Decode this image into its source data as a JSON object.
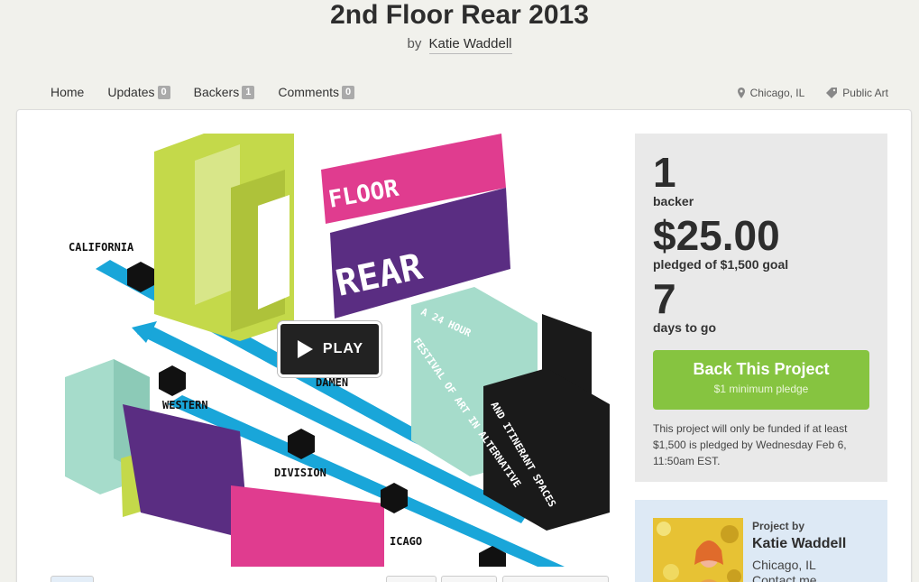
{
  "project": {
    "title": "2nd Floor Rear 2013",
    "by_label": "by",
    "creator": "Katie Waddell"
  },
  "nav": {
    "home": "Home",
    "updates": "Updates",
    "updates_count": "0",
    "backers": "Backers",
    "backers_count": "1",
    "comments": "Comments",
    "comments_count": "0"
  },
  "meta": {
    "location": "Chicago, IL",
    "category": "Public Art"
  },
  "video": {
    "play_label": "PLAY",
    "poster_text": {
      "california": "CALIFORNIA",
      "western": "WESTERN",
      "damen": "DAMEN",
      "division": "DIVISION",
      "chicago": "ICAGO",
      "floor": "FLOOR",
      "rear": "REAR",
      "hour": "A 24 HOUR",
      "festival": "FESTIVAL OF ART IN ALTERNATIVE",
      "spaces": "AND ITINERANT SPACES"
    }
  },
  "stats": {
    "backers_num": "1",
    "backers_label": "backer",
    "pledged_num": "$25.00",
    "pledged_label": "pledged of $1,500 goal",
    "days_num": "7",
    "days_label": "days to go"
  },
  "back": {
    "label": "Back This Project",
    "sub": "$1 minimum pledge"
  },
  "funding_note": "This project will only be funded if at least $1,500 is pledged by Wednesday Feb 6, 11:50am EST.",
  "creator_box": {
    "project_by": "Project by",
    "name": "Katie Waddell",
    "location": "Chicago, IL",
    "contact": "Contact me"
  },
  "colors": {
    "accent_green": "#86c440",
    "poster_lime": "#c4d94a",
    "poster_pink": "#e03c8f",
    "poster_purple": "#5a2d82",
    "poster_teal": "#a6dccb",
    "poster_blue": "#19a6d9"
  }
}
